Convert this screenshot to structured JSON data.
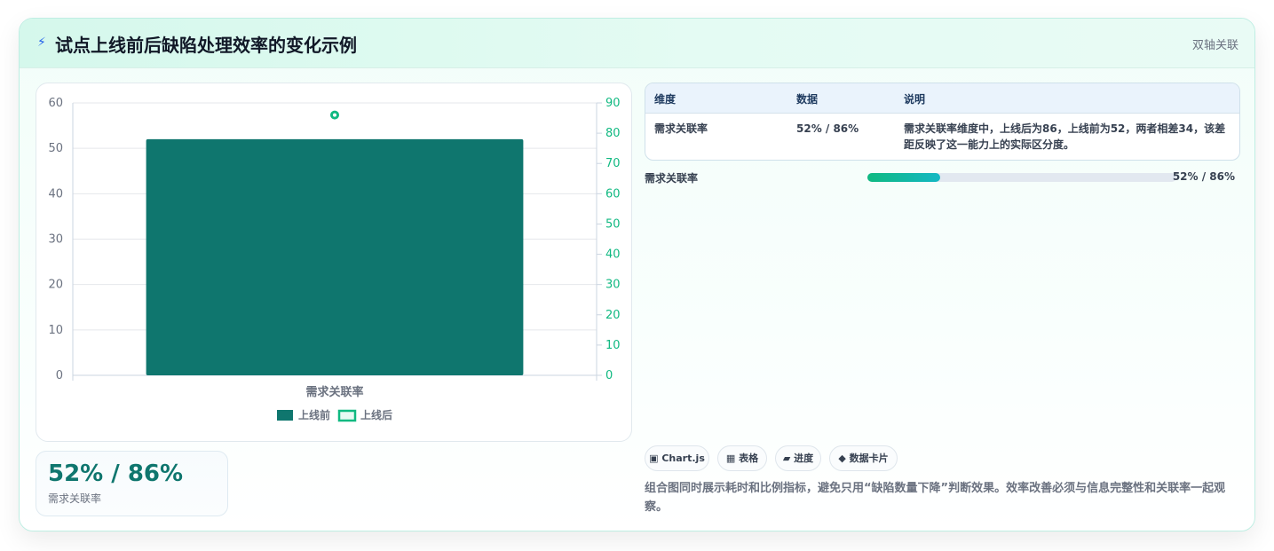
{
  "header": {
    "icon": "lightning-icon",
    "title": "试点上线前后缺陷处理效率的变化示例",
    "badge": "双轴关联"
  },
  "chart_data": {
    "type": "bar",
    "categories": [
      "需求关联率"
    ],
    "series": [
      {
        "name": "上线前",
        "values": [
          52
        ],
        "axis": "left",
        "mark": "bar",
        "color": "#0f766e"
      },
      {
        "name": "上线后",
        "values": [
          86
        ],
        "axis": "right",
        "mark": "point",
        "color": "#10b981"
      }
    ],
    "ylim": [
      0,
      60
    ],
    "y2lim": [
      0,
      90
    ],
    "yticks": [
      "0",
      "10",
      "20",
      "30",
      "40",
      "50",
      "60"
    ],
    "y2ticks": [
      "0",
      "10",
      "20",
      "30",
      "40",
      "50",
      "60",
      "70",
      "80",
      "90"
    ],
    "legend_position": "bottom",
    "grid": true
  },
  "kpi": {
    "value": "52% / 86%",
    "label": "需求关联率"
  },
  "table": {
    "headers": [
      "维度",
      "数据",
      "说明"
    ],
    "rows": [
      [
        "需求关联率",
        "52% / 86%",
        "需求关联率维度中，上线后为86，上线前为52，两者相差34，该差距反映了这一能力上的实际区分度。"
      ]
    ]
  },
  "progress": {
    "label": "需求关联率",
    "value_text": "52% / 86%",
    "fraction": 0.235
  },
  "chips": [
    {
      "icon": "▣",
      "label": "Chart.js"
    },
    {
      "icon": "▦",
      "label": "表格"
    },
    {
      "icon": "▰",
      "label": "进度"
    },
    {
      "icon": "◆",
      "label": "数据卡片"
    }
  ],
  "note": "组合图同时展示耗时和比例指标，避免只用“缺陷数量下降”判断效果。效率改善必须与信息完整性和关联率一起观察。",
  "colors": {
    "accent": "#0f766e",
    "secondary": "#10b981",
    "axis_right": "#10b981"
  }
}
